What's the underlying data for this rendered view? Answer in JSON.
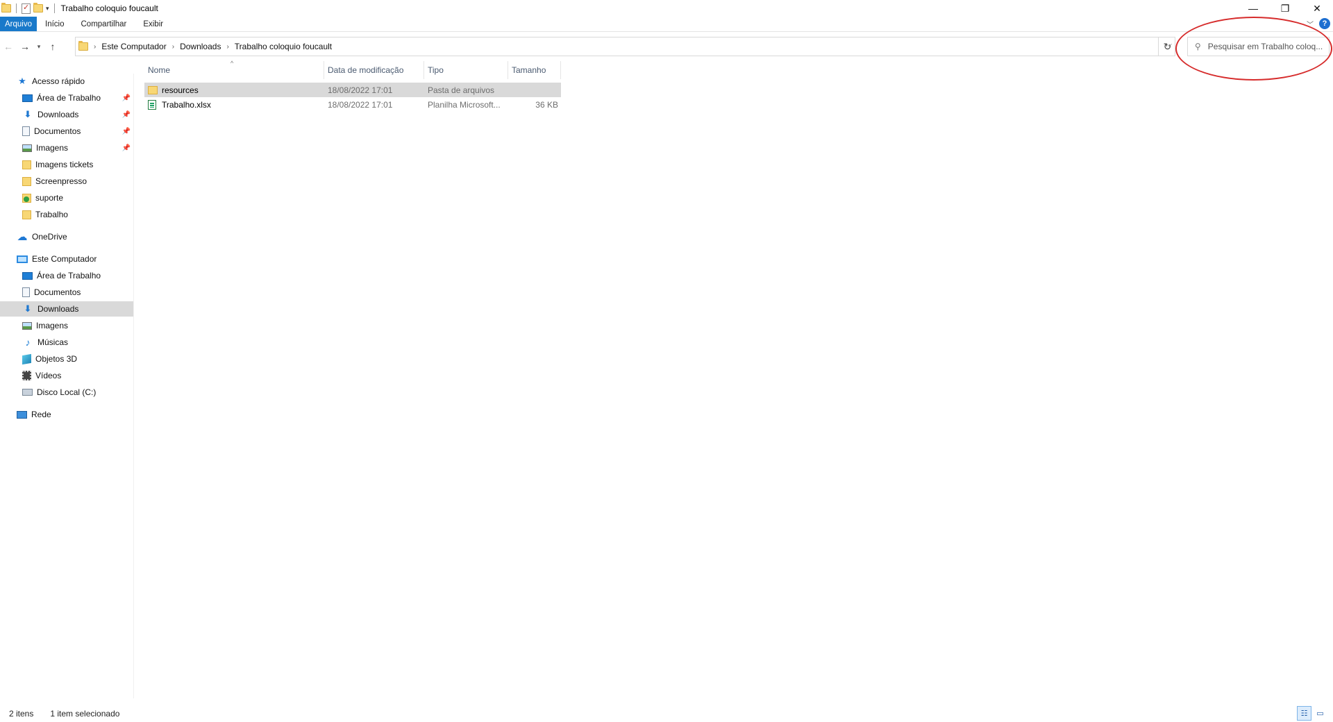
{
  "window": {
    "title": "Trabalho coloquio foucault"
  },
  "ribbon": {
    "tabs": [
      "Arquivo",
      "Início",
      "Compartilhar",
      "Exibir"
    ],
    "help_label": "?"
  },
  "address": {
    "crumbs": [
      "Este Computador",
      "Downloads",
      "Trabalho coloquio foucault"
    ]
  },
  "search": {
    "placeholder": "Pesquisar em Trabalho coloq..."
  },
  "nav": {
    "quick_access": {
      "label": "Acesso rápido",
      "items": [
        {
          "label": "Área de Trabalho",
          "icon": "desktop-icon",
          "pinned": true
        },
        {
          "label": "Downloads",
          "icon": "downloads-icon",
          "pinned": true
        },
        {
          "label": "Documentos",
          "icon": "documents-icon",
          "pinned": true
        },
        {
          "label": "Imagens",
          "icon": "pictures-icon",
          "pinned": true
        },
        {
          "label": "Imagens tickets",
          "icon": "folder-icon",
          "pinned": false
        },
        {
          "label": "Screenpresso",
          "icon": "folder-icon",
          "pinned": false
        },
        {
          "label": "suporte",
          "icon": "sync-folder-icon",
          "pinned": false
        },
        {
          "label": "Trabalho",
          "icon": "folder-icon",
          "pinned": false
        }
      ]
    },
    "onedrive": {
      "label": "OneDrive"
    },
    "this_pc": {
      "label": "Este Computador",
      "items": [
        {
          "label": "Área de Trabalho",
          "icon": "desktop-icon"
        },
        {
          "label": "Documentos",
          "icon": "documents-icon"
        },
        {
          "label": "Downloads",
          "icon": "downloads-icon",
          "selected": true
        },
        {
          "label": "Imagens",
          "icon": "pictures-icon"
        },
        {
          "label": "Músicas",
          "icon": "music-icon"
        },
        {
          "label": "Objetos 3D",
          "icon": "3d-objects-icon"
        },
        {
          "label": "Vídeos",
          "icon": "videos-icon"
        },
        {
          "label": "Disco Local (C:)",
          "icon": "local-disk-icon"
        }
      ]
    },
    "network": {
      "label": "Rede"
    }
  },
  "columns": [
    "Nome",
    "Data de modificação",
    "Tipo",
    "Tamanho"
  ],
  "files": [
    {
      "name": "resources",
      "modified": "18/08/2022 17:01",
      "type": "Pasta de arquivos",
      "size": "",
      "icon": "folder-icon",
      "selected": true
    },
    {
      "name": "Trabalho.xlsx",
      "modified": "18/08/2022 17:01",
      "type": "Planilha Microsoft...",
      "size": "36 KB",
      "icon": "excel-file-icon",
      "selected": false
    }
  ],
  "status": {
    "count": "2 itens",
    "selection": "1 item selecionado"
  },
  "colors": {
    "accent": "#1979ca",
    "selection": "#d9d9d9",
    "annotation": "#d62b2b"
  }
}
